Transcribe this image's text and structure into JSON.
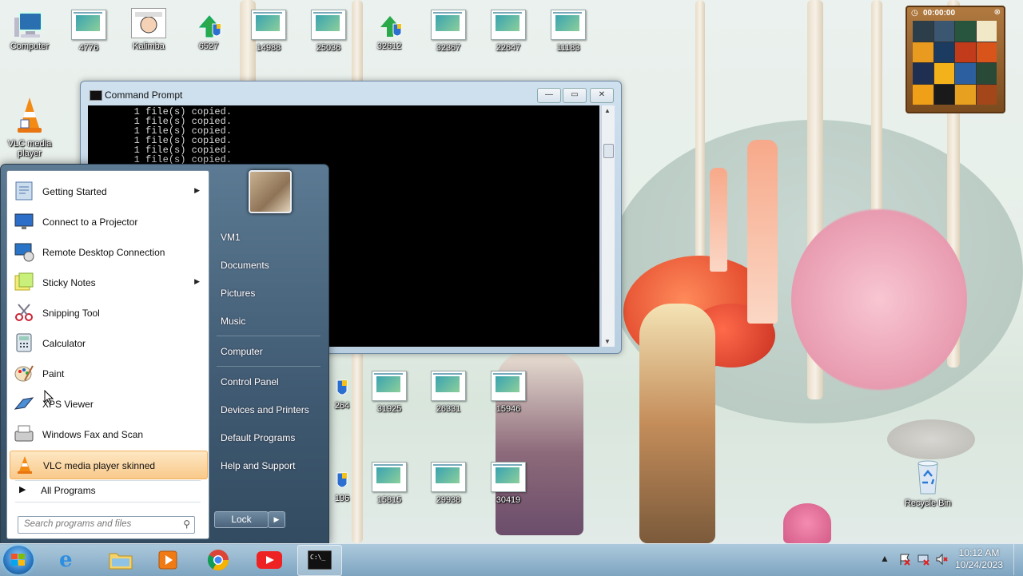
{
  "desktop": {
    "icons_top": [
      {
        "label": "Computer",
        "icon": "computer-icon"
      },
      {
        "label": "4776",
        "icon": "document-icon"
      },
      {
        "label": "Kalimba",
        "icon": "music-image-icon"
      },
      {
        "label": "6527",
        "icon": "shield-shortcut-icon"
      },
      {
        "label": "14988",
        "icon": "document-icon"
      },
      {
        "label": "25036",
        "icon": "document-icon"
      },
      {
        "label": "32612",
        "icon": "shield-shortcut-icon"
      },
      {
        "label": "32367",
        "icon": "document-icon"
      },
      {
        "label": "22647",
        "icon": "document-icon"
      },
      {
        "label": "11183",
        "icon": "document-icon"
      }
    ],
    "vlc_icon": {
      "label": "VLC media player",
      "icon": "vlc-cone-icon"
    },
    "icons_mid": [
      {
        "label": "264",
        "icon": "shield-shortcut-icon"
      },
      {
        "label": "31925",
        "icon": "document-icon"
      },
      {
        "label": "26331",
        "icon": "document-icon"
      },
      {
        "label": "15946",
        "icon": "document-icon"
      }
    ],
    "icons_low": [
      {
        "label": "196",
        "icon": "shield-shortcut-icon"
      },
      {
        "label": "15815",
        "icon": "document-icon"
      },
      {
        "label": "29938",
        "icon": "document-icon"
      },
      {
        "label": "30419",
        "icon": "document-icon"
      }
    ],
    "recycle_bin": {
      "label": "Recycle Bin",
      "icon": "recycle-bin-icon"
    },
    "puzzle_widget": {
      "timer": "00:00:00"
    }
  },
  "cmd_window": {
    "title": "Command Prompt",
    "lines": [
      "        1 file(s) copied.",
      "        1 file(s) copied.",
      "        1 file(s) copied.",
      "        1 file(s) copied.",
      "        1 file(s) copied.",
      "        1 file(s) copied."
    ],
    "minimize": "—",
    "maximize": "▭",
    "close": "✕"
  },
  "start_menu": {
    "programs": [
      {
        "label": "Getting Started",
        "icon": "getting-started-icon",
        "submenu": true
      },
      {
        "label": "Connect to a Projector",
        "icon": "projector-icon",
        "submenu": false
      },
      {
        "label": "Remote Desktop Connection",
        "icon": "remote-desktop-icon",
        "submenu": false
      },
      {
        "label": "Sticky Notes",
        "icon": "sticky-notes-icon",
        "submenu": true
      },
      {
        "label": "Snipping Tool",
        "icon": "scissors-icon",
        "submenu": false
      },
      {
        "label": "Calculator",
        "icon": "calculator-icon",
        "submenu": false
      },
      {
        "label": "Paint",
        "icon": "paint-palette-icon",
        "submenu": false
      },
      {
        "label": "XPS Viewer",
        "icon": "xps-viewer-icon",
        "submenu": false
      },
      {
        "label": "Windows Fax and Scan",
        "icon": "fax-icon",
        "submenu": false
      },
      {
        "label": "VLC media player skinned",
        "icon": "vlc-cone-icon",
        "submenu": false
      }
    ],
    "all_programs": "All Programs",
    "search_placeholder": "Search programs and files",
    "right_items": [
      {
        "label": "VM1"
      },
      {
        "label": "Documents"
      },
      {
        "label": "Pictures"
      },
      {
        "label": "Music"
      },
      {
        "label": "Computer"
      },
      {
        "label": "Control Panel"
      },
      {
        "label": "Devices and Printers"
      },
      {
        "label": "Default Programs"
      },
      {
        "label": "Help and Support"
      }
    ],
    "lock_label": "Lock",
    "lock_arrow": "▶"
  },
  "taskbar": {
    "apps": [
      {
        "name": "internet-explorer",
        "icon": "ie-icon"
      },
      {
        "name": "file-explorer",
        "icon": "folder-icon"
      },
      {
        "name": "media-player",
        "icon": "media-player-icon"
      },
      {
        "name": "chrome",
        "icon": "chrome-icon"
      },
      {
        "name": "youtube",
        "icon": "youtube-icon"
      },
      {
        "name": "command-prompt",
        "icon": "cmd-icon",
        "active": true
      }
    ],
    "clock_time": "10:12 AM",
    "clock_date": "10/24/2023"
  },
  "colors": {
    "accent": "#3f5a72",
    "highlight": "#f9c98a",
    "taskbar": "#86aecb"
  }
}
